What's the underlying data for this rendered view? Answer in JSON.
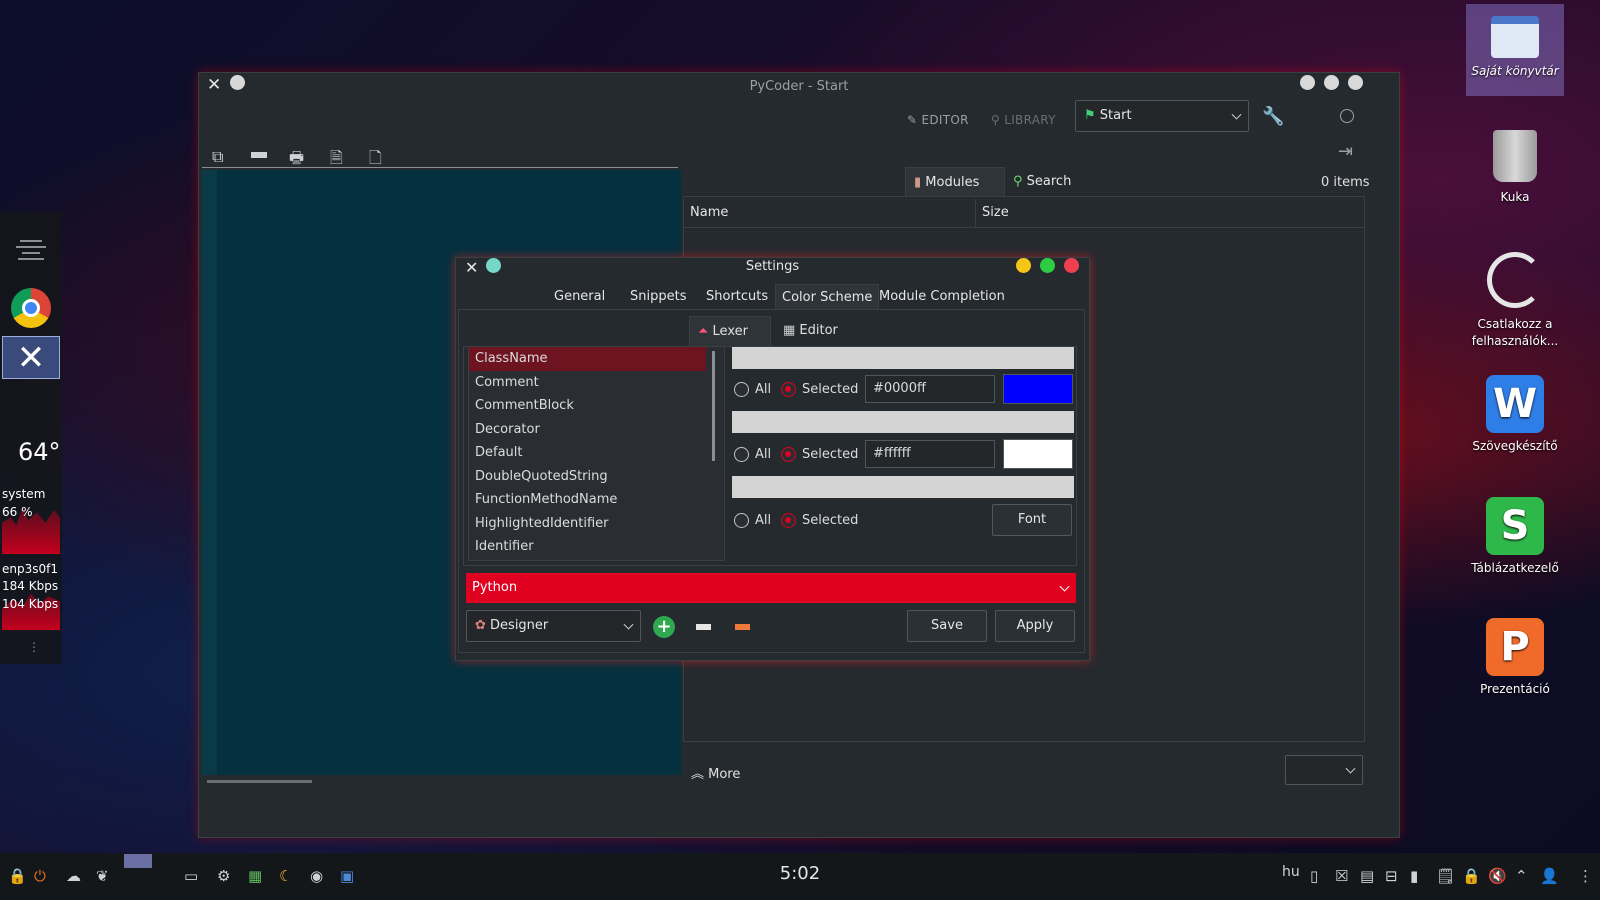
{
  "main_window": {
    "title": "PyCoder - Start",
    "editor_label": "EDITOR",
    "library_label": "LIBRARY",
    "project_select": "Start",
    "tabs": {
      "modules": "Modules",
      "search": "Search"
    },
    "items_count": "0 items",
    "columns": {
      "name": "Name",
      "size": "Size"
    },
    "more_label": "More"
  },
  "settings": {
    "title": "Settings",
    "tabs": [
      "General",
      "Snippets",
      "Shortcuts",
      "Color Scheme",
      "Module Completion"
    ],
    "subtabs": {
      "lexer": "Lexer",
      "editor": "Editor"
    },
    "list_items": [
      "ClassName",
      "Comment",
      "CommentBlock",
      "Decorator",
      "Default",
      "DoubleQuotedString",
      "FunctionMethodName",
      "HighlightedIdentifier",
      "Identifier"
    ],
    "radio_all": "All",
    "radio_selected": "Selected",
    "color1": "#0000ff",
    "color2": "#ffffff",
    "font_button": "Font",
    "language": "Python",
    "scheme": "Designer",
    "save_button": "Save",
    "apply_button": "Apply"
  },
  "widgets": {
    "temperature": "64°",
    "cpu_label": "system",
    "cpu_value": "66 %",
    "net_iface": "enp3s0f1",
    "net_down": "184 Kbps",
    "net_up": "104 Kbps"
  },
  "desktop_icons": [
    {
      "label": "Saját könyvtár"
    },
    {
      "label": "Kuka"
    },
    {
      "label": "Csatlakozz a felhasználók..."
    },
    {
      "label": "Szövegkészítő"
    },
    {
      "label": "Táblázatkezelő"
    },
    {
      "label": "Prezentáció"
    }
  ],
  "taskbar": {
    "clock": "5:02",
    "lang": "hu"
  },
  "colors": {
    "accent": "#e0001f",
    "editor_bg": "#05303e",
    "selected_item": "#6e1420",
    "swatch1": "#0000ff",
    "swatch2": "#ffffff"
  }
}
